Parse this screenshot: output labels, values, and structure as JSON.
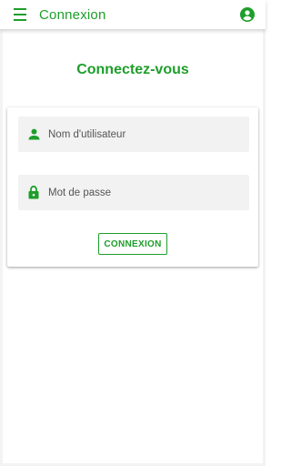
{
  "appbar": {
    "title": "Connexion",
    "menu_icon": "menu-icon",
    "account_icon": "account-circle-icon"
  },
  "login": {
    "heading": "Connectez-vous",
    "username": {
      "placeholder": "Nom d'utilisateur",
      "value": "",
      "icon": "person-icon"
    },
    "password": {
      "placeholder": "Mot de passe",
      "value": "",
      "icon": "lock-icon"
    },
    "submit_label": "CONNEXION"
  },
  "colors": {
    "accent": "#1e9e2a",
    "field_background": "#f2f2f2",
    "background": "#ffffff"
  }
}
